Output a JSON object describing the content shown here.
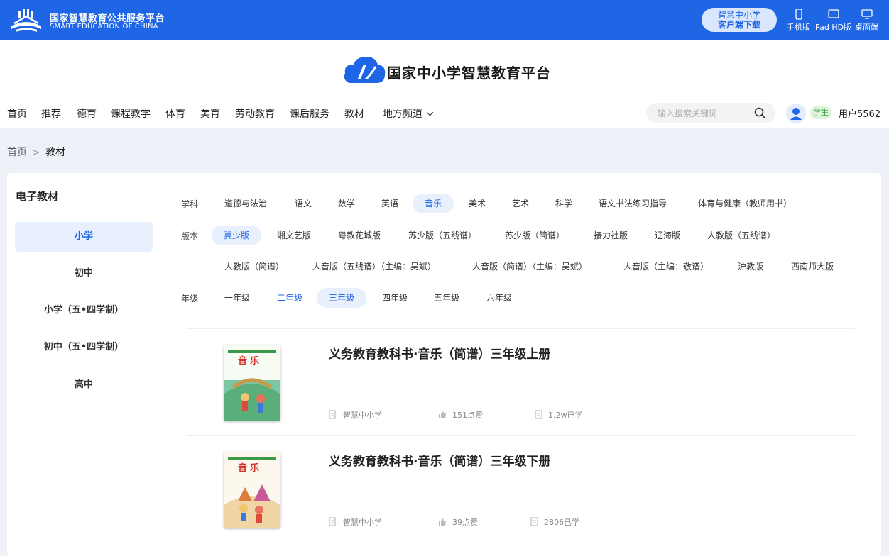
{
  "topbar": {
    "org_cn": "国家智慧教育公共服务平台",
    "org_en": "SMART EDUCATION OF CHINA",
    "download_line1": "智慧中小学",
    "download_line2": "客户端下载",
    "devices": [
      {
        "label": "手机版",
        "icon": "phone-icon"
      },
      {
        "label": "Pad HD版",
        "icon": "tablet-icon"
      },
      {
        "label": "桌面端",
        "icon": "desktop-icon"
      }
    ]
  },
  "header": {
    "brand_title": "国家中小学智慧教育平台",
    "nav": [
      "首页",
      "推荐",
      "德育",
      "课程教学",
      "体育",
      "美育",
      "劳动教育",
      "课后服务",
      "教材",
      "地方频道"
    ],
    "search_placeholder": "输入搜索关键词",
    "role_badge": "学生",
    "username": "用户5562"
  },
  "breadcrumb": {
    "home": "首页",
    "sep": ">",
    "current": "教材"
  },
  "sidebar": {
    "title": "电子教材",
    "items": [
      "小学",
      "初中",
      "小学（五•四学制）",
      "初中（五•四学制）",
      "高中"
    ],
    "active_index": 0
  },
  "filters": {
    "subject_label": "学科",
    "subjects": [
      "道德与法治",
      "语文",
      "数学",
      "英语",
      "音乐",
      "美术",
      "艺术",
      "科学",
      "语文书法练习指导",
      "体育与健康（教师用书）"
    ],
    "subject_selected": "音乐",
    "edition_label": "版本",
    "editions": [
      "冀少版",
      "湘文艺版",
      "粤教花城版",
      "苏少版（五线谱）",
      "苏少版（简谱）",
      "接力社版",
      "辽海版",
      "人教版（五线谱）",
      "人教版（简谱）",
      "人音版（五线谱）（主编：吴斌）",
      "人音版（简谱）（主编：吴斌）",
      "人音版（主编：敬谱）",
      "沪教版",
      "西南师大版"
    ],
    "edition_selected": "冀少版",
    "grade_label": "年级",
    "grades": [
      "一年级",
      "二年级",
      "三年级",
      "四年级",
      "五年级",
      "六年级"
    ],
    "grade_selected": "三年级",
    "grade_highlight": "二年级"
  },
  "books": [
    {
      "title": "义务教育教科书·音乐（简谱）三年级上册",
      "publisher": "智慧中小学",
      "likes": "151点赞",
      "learners": "1.2w已学",
      "cover_title": "音乐"
    },
    {
      "title": "义务教育教科书·音乐（简谱）三年级下册",
      "publisher": "智慧中小学",
      "likes": "39点赞",
      "learners": "2806已学",
      "cover_title": "音乐"
    }
  ],
  "colors": {
    "primary": "#1f66e6",
    "selected_bg": "#e8f0fd",
    "page_bg": "#eef2f8"
  }
}
